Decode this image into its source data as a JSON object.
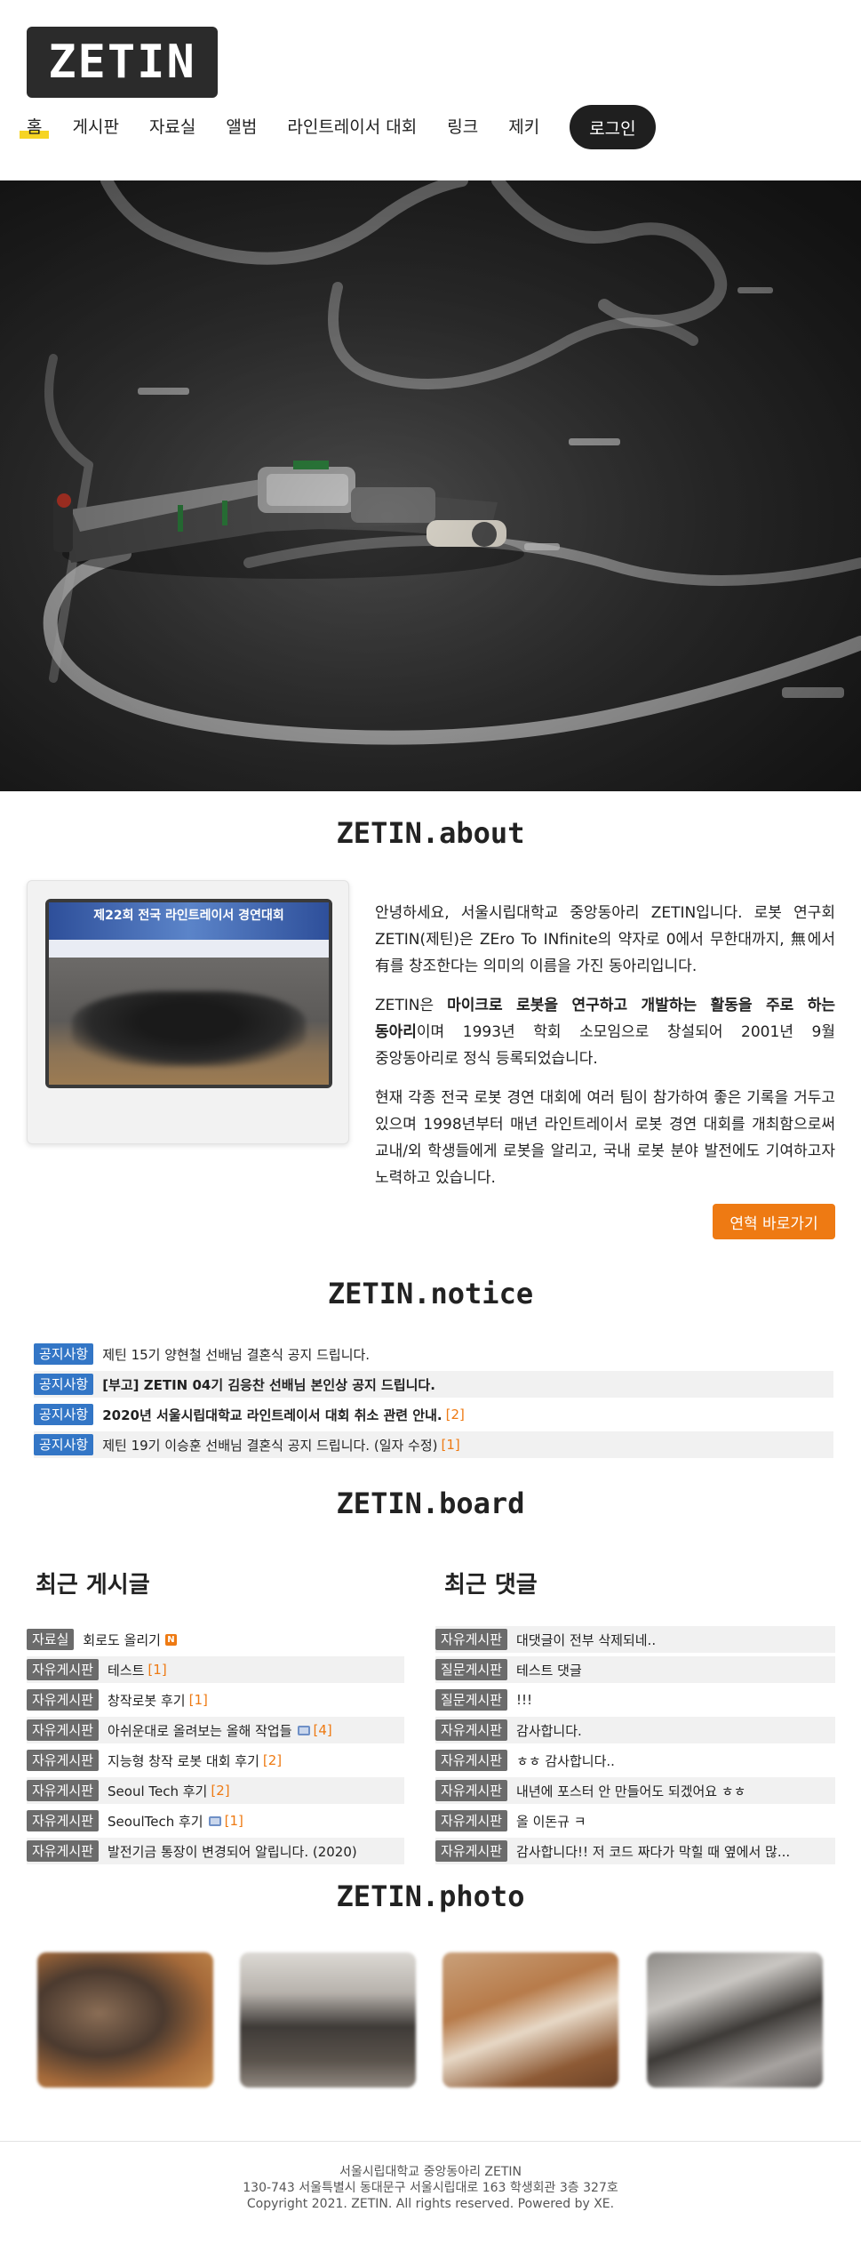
{
  "header": {
    "logo_text": "ZETIN",
    "nav": [
      {
        "label": "홈",
        "active": true
      },
      {
        "label": "게시판"
      },
      {
        "label": "자료실"
      },
      {
        "label": "앨범"
      },
      {
        "label": "라인트레이서 대회"
      },
      {
        "label": "링크"
      },
      {
        "label": "제키"
      }
    ],
    "login_label": "로그인",
    "accent_color": "#f6d423"
  },
  "about": {
    "title": "ZETIN.about",
    "photo_banner": "제22회 전국 라인트레이서 경연대회",
    "p1": "안녕하세요, 서울시립대학교 중앙동아리 ZETIN입니다. 로봇 연구회 ZETIN(제틴)은 ZEro To INfinite의 약자로 0에서 무한대까지, 無에서 有를 창조한다는 의미의 이름을 가진 동아리입니다.",
    "p2_pre": "ZETIN은 ",
    "p2_bold": "마이크로 로봇을 연구하고 개발하는 활동을 주로 하는 동아리",
    "p2_post": "이며 1993년 학회 소모임으로 창설되어 2001년 9월 중앙동아리로 정식 등록되었습니다.",
    "p3": "현재 각종 전국 로봇 경연 대회에 여러 팀이 참가하여 좋은 기록을 거두고 있으며 1998년부터 매년 라인트레이서 로봇 경연 대회를 개최함으로써 교내/외 학생들에게 로봇을 알리고, 국내 로봇 분야 발전에도 기여하고자 노력하고 있습니다.",
    "cta_label": "연혁 바로가기",
    "cta_color": "#ee7a13"
  },
  "notice": {
    "title": "ZETIN.notice",
    "items": [
      {
        "tag": "공지사항",
        "text": "제틴 15기 양현철 선배님 결혼식 공지 드립니다.",
        "count": "",
        "bold": false
      },
      {
        "tag": "공지사항",
        "text": "[부고] ZETIN 04기 김응찬 선배님 본인상 공지 드립니다.",
        "count": "",
        "bold": true
      },
      {
        "tag": "공지사항",
        "text": "2020년 서울시립대학교 라인트레이서 대회 취소 관련 안내.",
        "count": "[2]",
        "bold": true
      },
      {
        "tag": "공지사항",
        "text": "제틴 19기 이승훈 선배님 결혼식 공지 드립니다. (일자 수정)",
        "count": "[1]",
        "bold": false
      }
    ]
  },
  "board": {
    "title": "ZETIN.board",
    "recent_posts_title": "최근 게시글",
    "recent_comments_title": "최근 댓글",
    "posts": [
      {
        "tag": "자료실",
        "text": "회로도 올리기",
        "count": "",
        "icon": "new-icon"
      },
      {
        "tag": "자유게시판",
        "text": "테스트",
        "count": "[1]",
        "icon": ""
      },
      {
        "tag": "자유게시판",
        "text": "창작로봇 후기",
        "count": "[1]",
        "icon": ""
      },
      {
        "tag": "자유게시판",
        "text": "아쉬운대로 올려보는 올해 작업들",
        "count": "[4]",
        "icon": "image-icon"
      },
      {
        "tag": "자유게시판",
        "text": "지능형 창작 로봇 대회 후기",
        "count": "[2]",
        "icon": ""
      },
      {
        "tag": "자유게시판",
        "text": "Seoul Tech 후기",
        "count": "[2]",
        "icon": ""
      },
      {
        "tag": "자유게시판",
        "text": "SeoulTech 후기",
        "count": "[1]",
        "icon": "image-icon"
      },
      {
        "tag": "자유게시판",
        "text": "발전기금 통장이 변경되어 알립니다. (2020)",
        "count": "",
        "icon": ""
      }
    ],
    "comments": [
      {
        "tag": "자유게시판",
        "text": "대댓글이 전부 삭제되네.."
      },
      {
        "tag": "질문게시판",
        "text": "테스트 댓글"
      },
      {
        "tag": "질문게시판",
        "text": "!!!"
      },
      {
        "tag": "자유게시판",
        "text": "감사합니다."
      },
      {
        "tag": "자유게시판",
        "text": "ㅎㅎ 감사합니다.."
      },
      {
        "tag": "자유게시판",
        "text": "내년에 포스터 안 만들어도 되겠어요 ㅎㅎ"
      },
      {
        "tag": "자유게시판",
        "text": "올 이돈규 ㅋ"
      },
      {
        "tag": "자유게시판",
        "text": "감사합니다!! 저 코드 짜다가 막힐 때 옆에서 많..."
      }
    ]
  },
  "photo": {
    "title": "ZETIN.photo"
  },
  "footer": {
    "line1": "서울시립대학교 중앙동아리 ZETIN",
    "line2": "130-743 서울특별시 동대문구 서울시립대로 163 학생회관 3층 327호",
    "line3": "Copyright 2021. ZETIN. All rights reserved. Powered by XE."
  }
}
